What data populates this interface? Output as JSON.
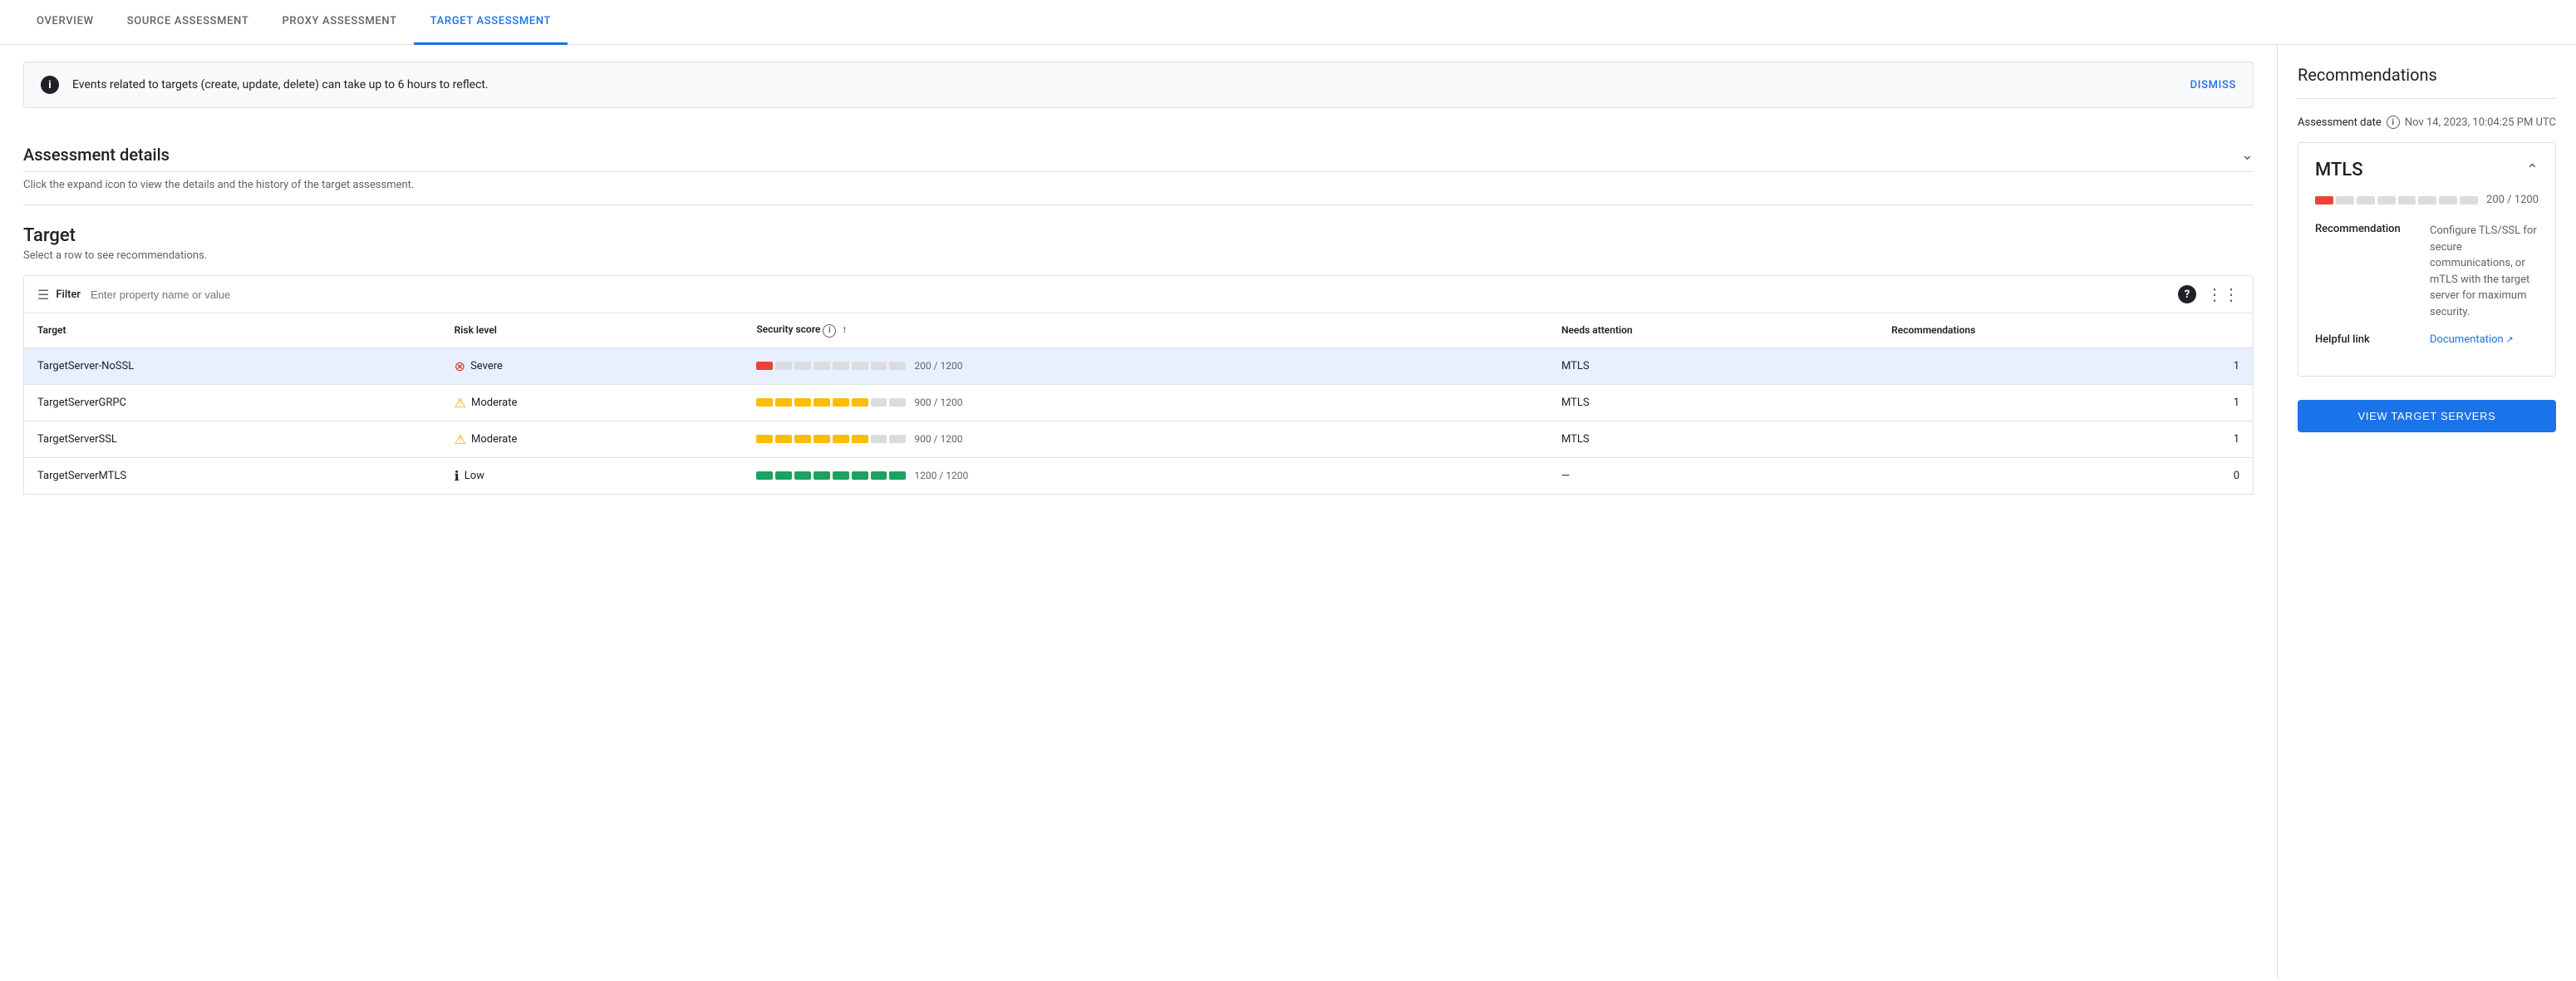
{
  "nav": {
    "tabs": [
      {
        "id": "overview",
        "label": "OVERVIEW",
        "active": false
      },
      {
        "id": "source",
        "label": "SOURCE ASSESSMENT",
        "active": false
      },
      {
        "id": "proxy",
        "label": "PROXY ASSESSMENT",
        "active": false
      },
      {
        "id": "target",
        "label": "TARGET ASSESSMENT",
        "active": true
      }
    ]
  },
  "banner": {
    "text": "Events related to targets (create, update, delete) can take up to 6 hours to reflect.",
    "dismiss_label": "DISMISS"
  },
  "assessment_details": {
    "title": "Assessment details",
    "description": "Click the expand icon to view the details and the history of the target assessment."
  },
  "target_section": {
    "title": "Target",
    "subtitle": "Select a row to see recommendations.",
    "filter_label": "Filter",
    "filter_placeholder": "Enter property name or value",
    "columns": [
      {
        "id": "target",
        "label": "Target"
      },
      {
        "id": "risk",
        "label": "Risk level"
      },
      {
        "id": "score",
        "label": "Security score"
      },
      {
        "id": "needs_attention",
        "label": "Needs attention"
      },
      {
        "id": "recommendations",
        "label": "Recommendations"
      }
    ],
    "rows": [
      {
        "id": "row1",
        "target": "TargetServer-NoSSL",
        "risk_level": "Severe",
        "risk_type": "severe",
        "score_value": "200 / 1200",
        "score_filled": 1,
        "score_total": 8,
        "score_color": "red",
        "needs_attention": "MTLS",
        "recommendations": "1",
        "selected": true
      },
      {
        "id": "row2",
        "target": "TargetServerGRPC",
        "risk_level": "Moderate",
        "risk_type": "moderate",
        "score_value": "900 / 1200",
        "score_filled": 6,
        "score_total": 8,
        "score_color": "orange",
        "needs_attention": "MTLS",
        "recommendations": "1",
        "selected": false
      },
      {
        "id": "row3",
        "target": "TargetServerSSL",
        "risk_level": "Moderate",
        "risk_type": "moderate",
        "score_value": "900 / 1200",
        "score_filled": 6,
        "score_total": 8,
        "score_color": "orange",
        "needs_attention": "MTLS",
        "recommendations": "1",
        "selected": false
      },
      {
        "id": "row4",
        "target": "TargetServerMTLS",
        "risk_level": "Low",
        "risk_type": "low",
        "score_value": "1200 / 1200",
        "score_filled": 8,
        "score_total": 8,
        "score_color": "teal",
        "needs_attention": "—",
        "recommendations": "0",
        "selected": false
      }
    ]
  },
  "sidebar": {
    "title": "Recommendations",
    "assessment_date_label": "Assessment date",
    "assessment_date_value": "Nov 14, 2023, 10:04:25 PM UTC",
    "mtls": {
      "title": "MTLS",
      "score_value": "200 / 1200",
      "score_filled": 1,
      "score_total": 8,
      "recommendation_label": "Recommendation",
      "recommendation_value": "Configure TLS/SSL for secure communications, or mTLS with the target server for maximum security.",
      "helpful_link_label": "Helpful link",
      "helpful_link_text": "Documentation",
      "helpful_link_url": "#"
    },
    "view_button_label": "VIEW TARGET SERVERS"
  }
}
